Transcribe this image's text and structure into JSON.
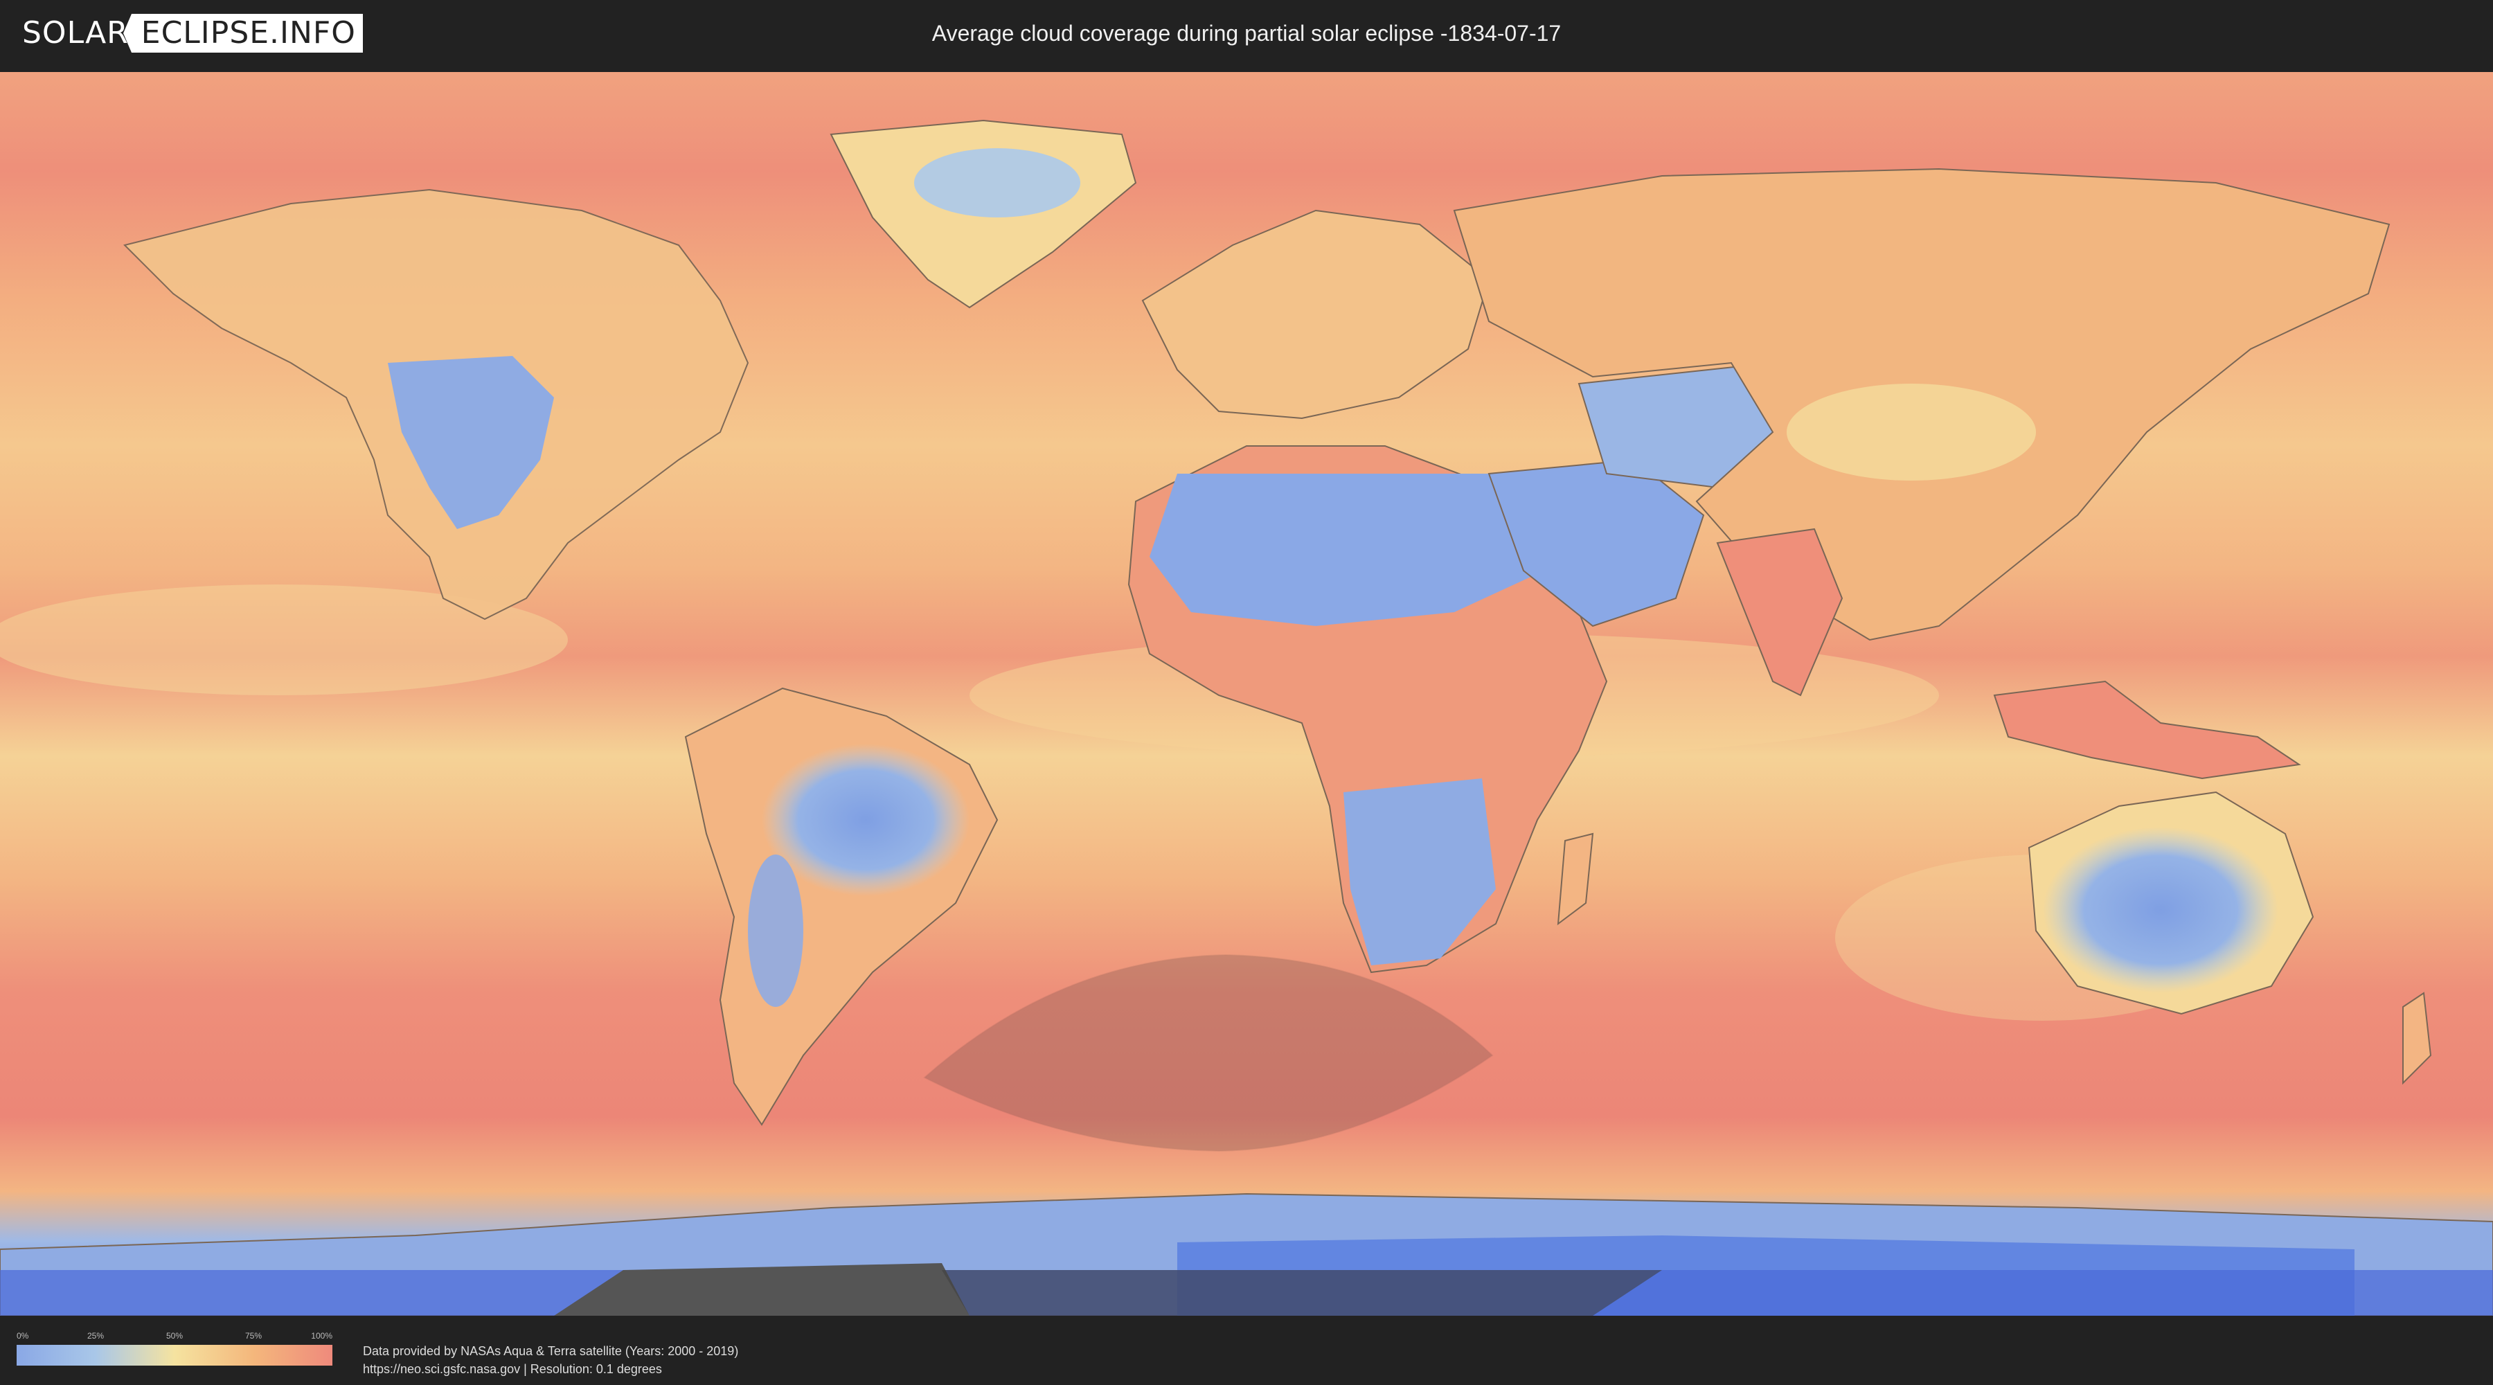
{
  "header": {
    "logo_left": "SOLAR",
    "logo_right": "ECLIPSE.INFO",
    "title": "Average cloud coverage during partial solar eclipse -1834-07-17"
  },
  "map": {
    "layer": "cloud-coverage",
    "eclipse_region": "partial-eclipse-visibility-zone",
    "colors": {
      "ocean_high": "#ee8f7a",
      "ocean_mid": "#f3b07f",
      "clear": "#8aa8e6",
      "partly": "#f5d99a",
      "ice_blue": "#5b7fe0",
      "eclipse_shade": "#8a6a66",
      "coast_line": "#6a5a50"
    }
  },
  "footer": {
    "legend": {
      "ticks": [
        "0%",
        "25%",
        "50%",
        "75%",
        "100%"
      ],
      "colors": [
        "#8aa8e6",
        "#a9c7e8",
        "#f5e3a0",
        "#f4b77c",
        "#ef8a7c"
      ]
    },
    "credit_line_1": "Data provided by NASAs Aqua & Terra satellite (Years: 2000 - 2019)",
    "credit_line_2": "https://neo.sci.gsfc.nasa.gov | Resolution: 0.1 degrees"
  }
}
